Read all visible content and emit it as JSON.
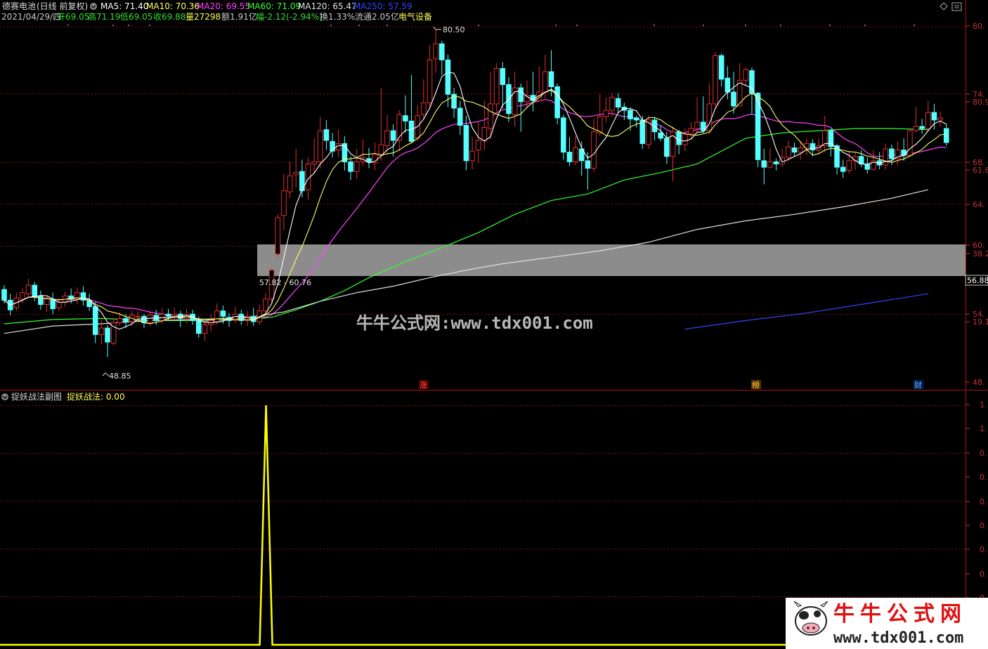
{
  "header": {
    "stock_name": "德赛电池",
    "period": "(日线 前复权)",
    "ma": [
      {
        "label": "MA5: 71.40",
        "color": "#ffffff"
      },
      {
        "label": "MA10: 70.36",
        "color": "#ffff66"
      },
      {
        "label": "MA20: 69.55",
        "color": "#ff44ff"
      },
      {
        "label": "MA60: 71.09",
        "color": "#33ff33"
      },
      {
        "label": "MA120: 65.47",
        "color": "#e0e0e0"
      },
      {
        "label": "MA250: 57.59",
        "color": "#3344ff"
      }
    ],
    "row2": [
      {
        "text": "2021/04/29/四",
        "color": "#c8c8c8"
      },
      {
        "text": "开69.05",
        "color": "#33dd33"
      },
      {
        "text": "高71.19",
        "color": "#33dd33"
      },
      {
        "text": "低69.05",
        "color": "#33dd33"
      },
      {
        "text": "收69.88",
        "color": "#33dd33"
      },
      {
        "text": "量27298",
        "color": "#ffff55"
      },
      {
        "text": "额1.91亿",
        "color": "#c8c8c8"
      },
      {
        "text": "幅-2.12(-2.94%)",
        "color": "#33dd33"
      },
      {
        "text": "换1.33%",
        "color": "#c8c8c8"
      },
      {
        "text": "流通2.05亿",
        "color": "#c8c8c8"
      },
      {
        "text": "电气设备",
        "color": "#ffff55"
      }
    ]
  },
  "sub": {
    "title": "捉妖战法副图",
    "indicator": "捉妖战法: 0.00",
    "y_labels": [
      "1.",
      "1.",
      "0.",
      "0.",
      "0.",
      "0.",
      "0.",
      "0.",
      "0.",
      "0."
    ]
  },
  "price_axis": {
    "labels": [
      {
        "text": "80.",
        "price": 80.5
      },
      {
        "text": "74.",
        "price": 74.5
      },
      {
        "text": "80.9",
        "price": 73.6
      },
      {
        "text": "68.",
        "price": 68.6
      },
      {
        "text": "61.8",
        "price": 67.7
      },
      {
        "text": "64.",
        "price": 64.8
      },
      {
        "text": "60.",
        "price": 61.0
      },
      {
        "text": "38.2",
        "price": 60.1
      },
      {
        "text": "56.88",
        "price": 56.88,
        "boxed": true
      },
      {
        "text": "54.",
        "price": 53.3
      },
      {
        "text": "19.1",
        "price": 52.4
      },
      {
        "text": "48.",
        "price": 47.5
      }
    ]
  },
  "annotations": {
    "high": "80.50",
    "low": "48.85",
    "range": "57.82 - 60.76",
    "markers": [
      "涨",
      "榜",
      "财"
    ]
  },
  "watermark": {
    "center": "牛牛公式网:www.tdx001.com",
    "logo_title": "牛牛公式网",
    "logo_url": "www.tdx001.com"
  },
  "chart_data": {
    "type": "candlestick",
    "price_scale": [
      47.5,
      80.5
    ],
    "candles": [
      [
        56.2,
        55.2,
        56.6,
        54.9
      ],
      [
        55.2,
        54.3,
        55.8,
        53.8
      ],
      [
        54.5,
        55.4,
        55.9,
        54.2
      ],
      [
        55.3,
        55.9,
        56.3,
        54.9
      ],
      [
        55.8,
        56.6,
        57.2,
        55.4
      ],
      [
        56.6,
        55.5,
        56.9,
        55.1
      ],
      [
        55.6,
        54.8,
        56.1,
        54.3
      ],
      [
        54.8,
        55.3,
        55.6,
        54.1
      ],
      [
        55.3,
        54.4,
        55.9,
        53.9
      ],
      [
        54.5,
        55.0,
        55.4,
        54.2
      ],
      [
        55.0,
        55.6,
        56.0,
        54.6
      ],
      [
        55.6,
        55.3,
        56.3,
        54.9
      ],
      [
        55.3,
        55.9,
        56.4,
        54.8
      ],
      [
        55.9,
        55.2,
        56.5,
        54.7
      ],
      [
        55.2,
        54.6,
        55.8,
        54.2
      ],
      [
        54.6,
        52.0,
        55.0,
        51.2
      ],
      [
        52.0,
        52.6,
        53.4,
        51.1
      ],
      [
        52.6,
        51.3,
        52.9,
        49.9
      ],
      [
        51.2,
        53.1,
        53.5,
        51.0
      ],
      [
        53.1,
        53.5,
        54.1,
        52.8
      ],
      [
        53.5,
        53.2,
        53.9,
        52.6
      ],
      [
        53.2,
        53.8,
        54.2,
        52.8
      ],
      [
        53.6,
        53.7,
        54.2,
        53.1
      ],
      [
        53.7,
        53.1,
        53.9,
        52.6
      ],
      [
        53.1,
        53.8,
        54.2,
        52.8
      ],
      [
        53.8,
        53.3,
        54.3,
        52.9
      ],
      [
        53.3,
        53.9,
        54.5,
        53.0
      ],
      [
        53.9,
        53.7,
        54.4,
        53.3
      ],
      [
        53.7,
        53.9,
        54.5,
        53.2
      ],
      [
        53.9,
        53.5,
        54.2,
        52.7
      ],
      [
        53.5,
        53.9,
        54.4,
        53.1
      ],
      [
        53.9,
        53.3,
        54.3,
        52.9
      ],
      [
        53.3,
        52.1,
        53.7,
        51.7
      ],
      [
        52.1,
        52.9,
        53.3,
        51.4
      ],
      [
        52.9,
        53.3,
        53.9,
        52.3
      ],
      [
        53.2,
        54.2,
        54.9,
        52.9
      ],
      [
        54.2,
        53.7,
        54.7,
        53.0
      ],
      [
        53.6,
        53.3,
        54.0,
        52.7
      ],
      [
        53.3,
        53.9,
        54.6,
        53.1
      ],
      [
        53.9,
        53.3,
        54.3,
        52.9
      ],
      [
        53.3,
        53.7,
        54.2,
        52.8
      ],
      [
        53.7,
        53.2,
        54.5,
        52.8
      ],
      [
        53.2,
        54.2,
        54.8,
        52.9
      ],
      [
        54.2,
        55.3,
        55.9,
        53.8
      ],
      [
        55.3,
        58.0,
        58.2,
        54.9
      ],
      [
        59.5,
        62.9,
        63.2,
        59.1
      ],
      [
        63.1,
        65.4,
        67.0,
        61.7
      ],
      [
        65.3,
        66.8,
        68.1,
        64.7
      ],
      [
        66.9,
        67.1,
        69.3,
        65.7
      ],
      [
        67.2,
        65.4,
        68.3,
        64.8
      ],
      [
        65.5,
        67.9,
        68.5,
        64.6
      ],
      [
        67.9,
        68.1,
        70.3,
        67.1
      ],
      [
        68.1,
        71.0,
        72.3,
        67.5
      ],
      [
        71.1,
        70.1,
        72.0,
        69.2
      ],
      [
        70.0,
        69.1,
        70.8,
        68.5
      ],
      [
        69.2,
        69.8,
        71.1,
        68.5
      ],
      [
        69.8,
        68.1,
        70.5,
        67.3
      ],
      [
        68.1,
        67.2,
        68.6,
        66.4
      ],
      [
        67.2,
        68.1,
        69.3,
        66.5
      ],
      [
        68.1,
        68.5,
        70.2,
        67.7
      ],
      [
        68.4,
        68.1,
        69.4,
        67.5
      ],
      [
        68.0,
        68.8,
        69.9,
        67.3
      ],
      [
        68.7,
        69.7,
        75.0,
        68.2
      ],
      [
        69.6,
        71.0,
        72.5,
        68.9
      ],
      [
        71.0,
        70.1,
        71.6,
        68.6
      ],
      [
        70.1,
        72.5,
        72.9,
        69.1
      ],
      [
        72.4,
        71.9,
        74.3,
        70.8
      ],
      [
        71.9,
        70.0,
        76.2,
        69.8
      ],
      [
        70.3,
        72.4,
        73.4,
        70.0
      ],
      [
        72.5,
        73.6,
        75.8,
        72.1
      ],
      [
        73.6,
        77.6,
        79.0,
        73.2
      ],
      [
        77.7,
        79.1,
        80.5,
        76.4
      ],
      [
        79.1,
        77.6,
        79.4,
        76.2
      ],
      [
        77.6,
        74.4,
        78.1,
        73.2
      ],
      [
        74.4,
        73.1,
        75.0,
        72.2
      ],
      [
        73.1,
        71.5,
        73.8,
        70.6
      ],
      [
        71.5,
        68.2,
        72.4,
        67.3
      ],
      [
        68.2,
        69.1,
        70.4,
        67.4
      ],
      [
        69.2,
        70.1,
        71.8,
        68.0
      ],
      [
        70.1,
        71.3,
        73.8,
        69.2
      ],
      [
        71.2,
        73.5,
        76.5,
        70.2
      ],
      [
        73.5,
        76.8,
        77.3,
        72.8
      ],
      [
        76.8,
        75.3,
        77.4,
        73.1
      ],
      [
        75.3,
        72.6,
        76.0,
        71.8
      ],
      [
        72.5,
        75.0,
        76.5,
        71.4
      ],
      [
        75.0,
        73.7,
        75.4,
        70.9
      ],
      [
        73.7,
        74.3,
        75.7,
        73.1
      ],
      [
        74.3,
        73.8,
        76.5,
        72.8
      ],
      [
        73.8,
        74.6,
        77.0,
        74.0
      ],
      [
        74.6,
        76.5,
        78.1,
        74.0
      ],
      [
        76.5,
        75.1,
        78.5,
        74.2
      ],
      [
        75.1,
        72.2,
        75.4,
        71.6
      ],
      [
        72.2,
        69.0,
        72.5,
        68.3
      ],
      [
        69.0,
        68.1,
        70.4,
        67.7
      ],
      [
        68.1,
        69.4,
        70.5,
        67.8
      ],
      [
        69.3,
        68.2,
        70.0,
        66.8
      ],
      [
        68.2,
        67.5,
        69.0,
        65.5
      ],
      [
        67.5,
        70.9,
        72.1,
        67.2
      ],
      [
        70.8,
        72.3,
        74.4,
        70.5
      ],
      [
        72.3,
        72.9,
        74.1,
        71.8
      ],
      [
        72.9,
        74.1,
        74.5,
        72.3
      ],
      [
        74.0,
        73.2,
        74.5,
        72.6
      ],
      [
        73.2,
        72.9,
        73.6,
        72.0
      ],
      [
        72.9,
        72.1,
        73.2,
        71.0
      ],
      [
        72.2,
        72.0,
        72.4,
        71.3
      ],
      [
        72.0,
        69.8,
        72.4,
        69.3
      ],
      [
        69.7,
        72.0,
        72.4,
        69.3
      ],
      [
        72.0,
        70.9,
        72.3,
        70.1
      ],
      [
        70.8,
        70.3,
        71.5,
        70.0
      ],
      [
        70.3,
        68.6,
        70.9,
        67.9
      ],
      [
        68.6,
        70.9,
        71.4,
        66.3
      ],
      [
        70.9,
        69.7,
        71.1,
        68.8
      ],
      [
        69.7,
        70.7,
        71.2,
        69.1
      ],
      [
        70.7,
        71.2,
        71.8,
        70.2
      ],
      [
        71.2,
        71.8,
        74.1,
        70.9
      ],
      [
        71.8,
        71.0,
        74.2,
        70.8
      ],
      [
        71.0,
        73.5,
        75.4,
        70.7
      ],
      [
        73.5,
        78.0,
        78.3,
        73.2
      ],
      [
        78.0,
        75.8,
        78.2,
        75.1
      ],
      [
        75.9,
        74.6,
        77.0,
        73.9
      ],
      [
        74.6,
        73.3,
        76.5,
        72.6
      ],
      [
        73.3,
        75.7,
        77.3,
        73.3
      ],
      [
        75.7,
        76.7,
        76.9,
        75.2
      ],
      [
        76.6,
        74.5,
        76.9,
        72.5
      ],
      [
        74.5,
        68.3,
        74.6,
        67.6
      ],
      [
        68.2,
        67.6,
        69.3,
        66.0
      ],
      [
        67.6,
        68.1,
        69.4,
        67.5
      ],
      [
        68.1,
        67.9,
        68.4,
        67.3
      ],
      [
        67.9,
        68.5,
        69.3,
        67.6
      ],
      [
        68.5,
        69.5,
        70.1,
        68.2
      ],
      [
        69.4,
        69.0,
        69.9,
        68.6
      ],
      [
        69.0,
        69.4,
        70.0,
        68.3
      ],
      [
        69.4,
        69.8,
        70.2,
        68.7
      ],
      [
        69.8,
        69.2,
        70.2,
        68.6
      ],
      [
        69.2,
        69.6,
        70.3,
        68.8
      ],
      [
        69.6,
        71.0,
        72.4,
        69.0
      ],
      [
        71.0,
        69.5,
        71.2,
        68.6
      ],
      [
        69.6,
        67.6,
        69.8,
        66.9
      ],
      [
        67.6,
        67.2,
        68.3,
        66.6
      ],
      [
        67.3,
        68.2,
        69.1,
        67.0
      ],
      [
        68.2,
        68.6,
        69.0,
        67.4
      ],
      [
        68.6,
        67.9,
        69.2,
        67.6
      ],
      [
        67.9,
        67.4,
        68.5,
        67.0
      ],
      [
        67.4,
        68.2,
        69.2,
        67.3
      ],
      [
        68.2,
        67.8,
        69.0,
        67.4
      ],
      [
        67.8,
        69.3,
        69.8,
        67.4
      ],
      [
        69.3,
        68.4,
        69.7,
        67.8
      ],
      [
        68.4,
        69.2,
        70.0,
        67.8
      ],
      [
        69.2,
        68.7,
        70.3,
        68.2
      ],
      [
        68.7,
        71.0,
        71.3,
        68.5
      ],
      [
        71.0,
        71.4,
        73.2,
        70.8
      ],
      [
        71.4,
        71.2,
        72.1,
        70.7
      ],
      [
        71.2,
        72.7,
        73.8,
        70.9
      ],
      [
        72.7,
        72.0,
        73.5,
        71.1
      ],
      [
        72.0,
        72.2,
        72.8,
        71.4
      ],
      [
        71.2,
        69.9,
        71.6,
        69.6
      ]
    ],
    "ma120": [
      [
        0,
        52.1
      ],
      [
        8,
        52.8
      ],
      [
        16,
        53.0
      ],
      [
        24,
        53.3
      ],
      [
        32,
        53.4
      ],
      [
        40,
        53.6
      ],
      [
        46,
        54.1
      ],
      [
        52,
        55.1
      ],
      [
        58,
        55.9
      ],
      [
        64,
        56.5
      ],
      [
        70,
        57.3
      ],
      [
        76,
        58.0
      ],
      [
        82,
        58.6
      ],
      [
        90,
        59.2
      ],
      [
        98,
        59.8
      ],
      [
        106,
        60.6
      ],
      [
        114,
        61.8
      ],
      [
        122,
        62.6
      ],
      [
        130,
        63.2
      ],
      [
        138,
        63.9
      ],
      [
        146,
        64.7
      ],
      [
        152,
        65.5
      ]
    ],
    "ma60": [
      [
        0,
        53.0
      ],
      [
        8,
        53.4
      ],
      [
        16,
        53.5
      ],
      [
        24,
        53.3
      ],
      [
        32,
        53.3
      ],
      [
        40,
        53.4
      ],
      [
        44,
        53.6
      ],
      [
        48,
        54.3
      ],
      [
        52,
        55.1
      ],
      [
        56,
        56.1
      ],
      [
        60,
        57.3
      ],
      [
        66,
        58.8
      ],
      [
        72,
        60.1
      ],
      [
        78,
        61.5
      ],
      [
        84,
        63.2
      ],
      [
        90,
        64.5
      ],
      [
        96,
        65.1
      ],
      [
        102,
        66.4
      ],
      [
        108,
        67.1
      ],
      [
        114,
        67.9
      ],
      [
        118,
        69.1
      ],
      [
        122,
        70.3
      ],
      [
        128,
        70.8
      ],
      [
        134,
        71.0
      ],
      [
        140,
        71.2
      ],
      [
        146,
        71.2
      ],
      [
        152,
        71.1
      ]
    ],
    "ma250": [
      [
        112,
        52.5
      ],
      [
        122,
        53.3
      ],
      [
        132,
        54.0
      ],
      [
        142,
        54.9
      ],
      [
        152,
        55.8
      ]
    ],
    "highlight_band": [
      57.82,
      60.76
    ],
    "sub_signal": {
      "spike_index": 44,
      "value_range": [
        0,
        1
      ]
    }
  }
}
